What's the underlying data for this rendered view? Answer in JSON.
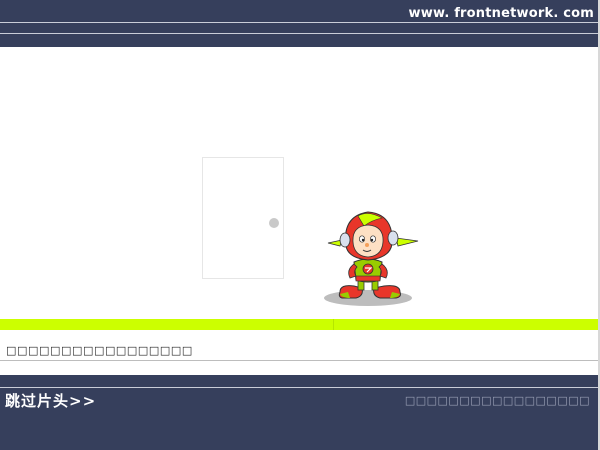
{
  "header": {
    "site_url": "www. frontnetwork. com"
  },
  "loader": {
    "status_text": "□□□□□□□□□□□□□□□□□"
  },
  "footer": {
    "skip_label": "跳过片头>>",
    "note_text": "□□□□□□□□□□□□□□□□□"
  },
  "colors": {
    "banner": "#363f5c",
    "accent": "#ccff00",
    "background": "#ffffff"
  },
  "icons": {
    "character": "cartoon-kid-icon",
    "door": "door-icon"
  }
}
